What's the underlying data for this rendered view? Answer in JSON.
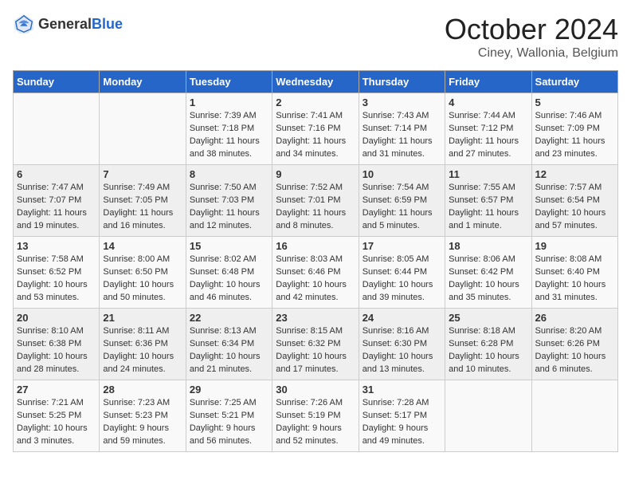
{
  "header": {
    "logo_general": "General",
    "logo_blue": "Blue",
    "month": "October 2024",
    "location": "Ciney, Wallonia, Belgium"
  },
  "days_of_week": [
    "Sunday",
    "Monday",
    "Tuesday",
    "Wednesday",
    "Thursday",
    "Friday",
    "Saturday"
  ],
  "weeks": [
    [
      {
        "day": "",
        "sunrise": "",
        "sunset": "",
        "daylight": ""
      },
      {
        "day": "",
        "sunrise": "",
        "sunset": "",
        "daylight": ""
      },
      {
        "day": "1",
        "sunrise": "Sunrise: 7:39 AM",
        "sunset": "Sunset: 7:18 PM",
        "daylight": "Daylight: 11 hours and 38 minutes."
      },
      {
        "day": "2",
        "sunrise": "Sunrise: 7:41 AM",
        "sunset": "Sunset: 7:16 PM",
        "daylight": "Daylight: 11 hours and 34 minutes."
      },
      {
        "day": "3",
        "sunrise": "Sunrise: 7:43 AM",
        "sunset": "Sunset: 7:14 PM",
        "daylight": "Daylight: 11 hours and 31 minutes."
      },
      {
        "day": "4",
        "sunrise": "Sunrise: 7:44 AM",
        "sunset": "Sunset: 7:12 PM",
        "daylight": "Daylight: 11 hours and 27 minutes."
      },
      {
        "day": "5",
        "sunrise": "Sunrise: 7:46 AM",
        "sunset": "Sunset: 7:09 PM",
        "daylight": "Daylight: 11 hours and 23 minutes."
      }
    ],
    [
      {
        "day": "6",
        "sunrise": "Sunrise: 7:47 AM",
        "sunset": "Sunset: 7:07 PM",
        "daylight": "Daylight: 11 hours and 19 minutes."
      },
      {
        "day": "7",
        "sunrise": "Sunrise: 7:49 AM",
        "sunset": "Sunset: 7:05 PM",
        "daylight": "Daylight: 11 hours and 16 minutes."
      },
      {
        "day": "8",
        "sunrise": "Sunrise: 7:50 AM",
        "sunset": "Sunset: 7:03 PM",
        "daylight": "Daylight: 11 hours and 12 minutes."
      },
      {
        "day": "9",
        "sunrise": "Sunrise: 7:52 AM",
        "sunset": "Sunset: 7:01 PM",
        "daylight": "Daylight: 11 hours and 8 minutes."
      },
      {
        "day": "10",
        "sunrise": "Sunrise: 7:54 AM",
        "sunset": "Sunset: 6:59 PM",
        "daylight": "Daylight: 11 hours and 5 minutes."
      },
      {
        "day": "11",
        "sunrise": "Sunrise: 7:55 AM",
        "sunset": "Sunset: 6:57 PM",
        "daylight": "Daylight: 11 hours and 1 minute."
      },
      {
        "day": "12",
        "sunrise": "Sunrise: 7:57 AM",
        "sunset": "Sunset: 6:54 PM",
        "daylight": "Daylight: 10 hours and 57 minutes."
      }
    ],
    [
      {
        "day": "13",
        "sunrise": "Sunrise: 7:58 AM",
        "sunset": "Sunset: 6:52 PM",
        "daylight": "Daylight: 10 hours and 53 minutes."
      },
      {
        "day": "14",
        "sunrise": "Sunrise: 8:00 AM",
        "sunset": "Sunset: 6:50 PM",
        "daylight": "Daylight: 10 hours and 50 minutes."
      },
      {
        "day": "15",
        "sunrise": "Sunrise: 8:02 AM",
        "sunset": "Sunset: 6:48 PM",
        "daylight": "Daylight: 10 hours and 46 minutes."
      },
      {
        "day": "16",
        "sunrise": "Sunrise: 8:03 AM",
        "sunset": "Sunset: 6:46 PM",
        "daylight": "Daylight: 10 hours and 42 minutes."
      },
      {
        "day": "17",
        "sunrise": "Sunrise: 8:05 AM",
        "sunset": "Sunset: 6:44 PM",
        "daylight": "Daylight: 10 hours and 39 minutes."
      },
      {
        "day": "18",
        "sunrise": "Sunrise: 8:06 AM",
        "sunset": "Sunset: 6:42 PM",
        "daylight": "Daylight: 10 hours and 35 minutes."
      },
      {
        "day": "19",
        "sunrise": "Sunrise: 8:08 AM",
        "sunset": "Sunset: 6:40 PM",
        "daylight": "Daylight: 10 hours and 31 minutes."
      }
    ],
    [
      {
        "day": "20",
        "sunrise": "Sunrise: 8:10 AM",
        "sunset": "Sunset: 6:38 PM",
        "daylight": "Daylight: 10 hours and 28 minutes."
      },
      {
        "day": "21",
        "sunrise": "Sunrise: 8:11 AM",
        "sunset": "Sunset: 6:36 PM",
        "daylight": "Daylight: 10 hours and 24 minutes."
      },
      {
        "day": "22",
        "sunrise": "Sunrise: 8:13 AM",
        "sunset": "Sunset: 6:34 PM",
        "daylight": "Daylight: 10 hours and 21 minutes."
      },
      {
        "day": "23",
        "sunrise": "Sunrise: 8:15 AM",
        "sunset": "Sunset: 6:32 PM",
        "daylight": "Daylight: 10 hours and 17 minutes."
      },
      {
        "day": "24",
        "sunrise": "Sunrise: 8:16 AM",
        "sunset": "Sunset: 6:30 PM",
        "daylight": "Daylight: 10 hours and 13 minutes."
      },
      {
        "day": "25",
        "sunrise": "Sunrise: 8:18 AM",
        "sunset": "Sunset: 6:28 PM",
        "daylight": "Daylight: 10 hours and 10 minutes."
      },
      {
        "day": "26",
        "sunrise": "Sunrise: 8:20 AM",
        "sunset": "Sunset: 6:26 PM",
        "daylight": "Daylight: 10 hours and 6 minutes."
      }
    ],
    [
      {
        "day": "27",
        "sunrise": "Sunrise: 7:21 AM",
        "sunset": "Sunset: 5:25 PM",
        "daylight": "Daylight: 10 hours and 3 minutes."
      },
      {
        "day": "28",
        "sunrise": "Sunrise: 7:23 AM",
        "sunset": "Sunset: 5:23 PM",
        "daylight": "Daylight: 9 hours and 59 minutes."
      },
      {
        "day": "29",
        "sunrise": "Sunrise: 7:25 AM",
        "sunset": "Sunset: 5:21 PM",
        "daylight": "Daylight: 9 hours and 56 minutes."
      },
      {
        "day": "30",
        "sunrise": "Sunrise: 7:26 AM",
        "sunset": "Sunset: 5:19 PM",
        "daylight": "Daylight: 9 hours and 52 minutes."
      },
      {
        "day": "31",
        "sunrise": "Sunrise: 7:28 AM",
        "sunset": "Sunset: 5:17 PM",
        "daylight": "Daylight: 9 hours and 49 minutes."
      },
      {
        "day": "",
        "sunrise": "",
        "sunset": "",
        "daylight": ""
      },
      {
        "day": "",
        "sunrise": "",
        "sunset": "",
        "daylight": ""
      }
    ]
  ]
}
